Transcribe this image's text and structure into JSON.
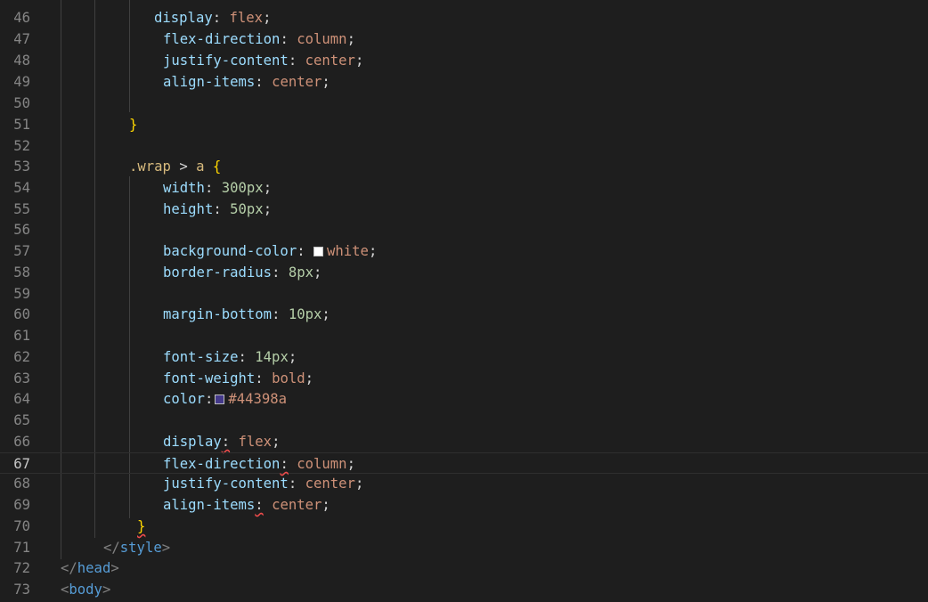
{
  "editor": {
    "colors": {
      "background": "#1e1e1e",
      "white_swatch": "#ffffff",
      "purple_swatch": "#44398a"
    },
    "lines": [
      {
        "n": "46",
        "prop": "display",
        "val": "flex"
      },
      {
        "n": "47",
        "prop": "flex-direction",
        "val": "column"
      },
      {
        "n": "48",
        "prop": "justify-content",
        "val": "center"
      },
      {
        "n": "49",
        "prop": "align-items",
        "val": "center"
      },
      {
        "n": "50"
      },
      {
        "n": "51",
        "brace": "}"
      },
      {
        "n": "52"
      },
      {
        "n": "53",
        "selector": ".wrap",
        "combinator": ">",
        "element": "a",
        "brace": "{"
      },
      {
        "n": "54",
        "prop": "width",
        "num": "300px"
      },
      {
        "n": "55",
        "prop": "height",
        "num": "50px"
      },
      {
        "n": "56"
      },
      {
        "n": "57",
        "prop": "background-color",
        "val": "white"
      },
      {
        "n": "58",
        "prop": "border-radius",
        "num": "8px"
      },
      {
        "n": "59"
      },
      {
        "n": "60",
        "prop": "margin-bottom",
        "num": "10px"
      },
      {
        "n": "61"
      },
      {
        "n": "62",
        "prop": "font-size",
        "num": "14px"
      },
      {
        "n": "63",
        "prop": "font-weight",
        "val": "bold"
      },
      {
        "n": "64",
        "prop": "color",
        "val": "#44398a"
      },
      {
        "n": "65"
      },
      {
        "n": "66",
        "prop": "display",
        "val": "flex"
      },
      {
        "n": "67",
        "prop": "flex-direction",
        "val": "column"
      },
      {
        "n": "68",
        "prop": "justify-content",
        "val": "center"
      },
      {
        "n": "69",
        "prop": "align-items",
        "val": "center"
      },
      {
        "n": "70",
        "brace": "}"
      },
      {
        "n": "71",
        "tag": "style"
      },
      {
        "n": "72",
        "tag": "head"
      },
      {
        "n": "73",
        "tag": "body"
      }
    ]
  }
}
